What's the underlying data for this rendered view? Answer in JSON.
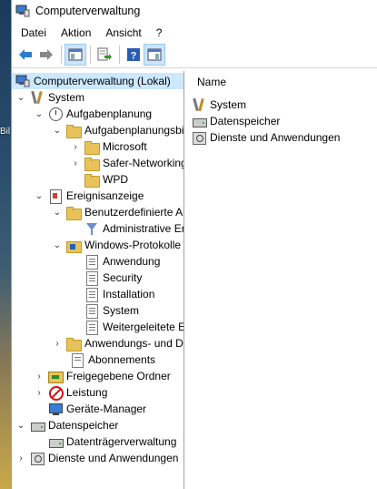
{
  "window": {
    "title": "Computerverwaltung"
  },
  "desktop": {
    "label": "Bil"
  },
  "menu": {
    "items": [
      "Datei",
      "Aktion",
      "Ansicht",
      "?"
    ]
  },
  "toolbar": {
    "buttons": [
      "back-arrow-icon",
      "forward-arrow-icon",
      "show-hide-console-tree-icon",
      "export-list-icon",
      "help-icon",
      "show-hide-action-pane-icon"
    ]
  },
  "tree": {
    "items": [
      {
        "label": "Computerverwaltung (Lokal)",
        "expander": "",
        "icon": "computer-management-icon",
        "selected": true
      },
      {
        "label": "System",
        "expander": "expanded",
        "icon": "system-tools-icon"
      },
      {
        "label": "Aufgabenplanung",
        "expander": "expanded",
        "icon": "task-scheduler-icon"
      },
      {
        "label": "Aufgabenplanungsbibliothek",
        "expander": "expanded",
        "icon": "folder-clock-icon"
      },
      {
        "label": "Microsoft",
        "expander": "collapsed",
        "icon": "folder-icon"
      },
      {
        "label": "Safer-Networking",
        "expander": "collapsed",
        "icon": "folder-icon"
      },
      {
        "label": "WPD",
        "expander": "",
        "icon": "folder-icon"
      },
      {
        "label": "Ereignisanzeige",
        "expander": "expanded",
        "icon": "event-viewer-icon"
      },
      {
        "label": "Benutzerdefinierte Ansichten",
        "expander": "expanded",
        "icon": "folder-filter-icon"
      },
      {
        "label": "Administrative Ereignisse",
        "expander": "",
        "icon": "filter-icon"
      },
      {
        "label": "Windows-Protokolle",
        "expander": "expanded",
        "icon": "windows-logs-icon"
      },
      {
        "label": "Anwendung",
        "expander": "",
        "icon": "log-icon"
      },
      {
        "label": "Security",
        "expander": "",
        "icon": "log-icon"
      },
      {
        "label": "Installation",
        "expander": "",
        "icon": "log-icon"
      },
      {
        "label": "System",
        "expander": "",
        "icon": "log-icon"
      },
      {
        "label": "Weitergeleitete Ereignisse",
        "expander": "",
        "icon": "log-icon"
      },
      {
        "label": "Anwendungs- und Dienstprotokolle",
        "expander": "collapsed",
        "icon": "folder-icon"
      },
      {
        "label": "Abonnements",
        "expander": "",
        "icon": "subscriptions-icon"
      },
      {
        "label": "Freigegebene Ordner",
        "expander": "collapsed",
        "icon": "shared-folders-icon"
      },
      {
        "label": "Leistung",
        "expander": "collapsed",
        "icon": "performance-icon"
      },
      {
        "label": "Geräte-Manager",
        "expander": "",
        "icon": "device-manager-icon"
      },
      {
        "label": "Datenspeicher",
        "expander": "expanded",
        "icon": "storage-icon"
      },
      {
        "label": "Datenträgerverwaltung",
        "expander": "",
        "icon": "disk-management-icon"
      },
      {
        "label": "Dienste und Anwendungen",
        "expander": "collapsed",
        "icon": "services-applications-icon"
      }
    ]
  },
  "content": {
    "column_header": "Name",
    "items": [
      {
        "label": "System",
        "icon": "system-tools-icon"
      },
      {
        "label": "Datenspeicher",
        "icon": "storage-icon"
      },
      {
        "label": "Dienste und Anwendungen",
        "icon": "services-applications-icon"
      }
    ]
  }
}
